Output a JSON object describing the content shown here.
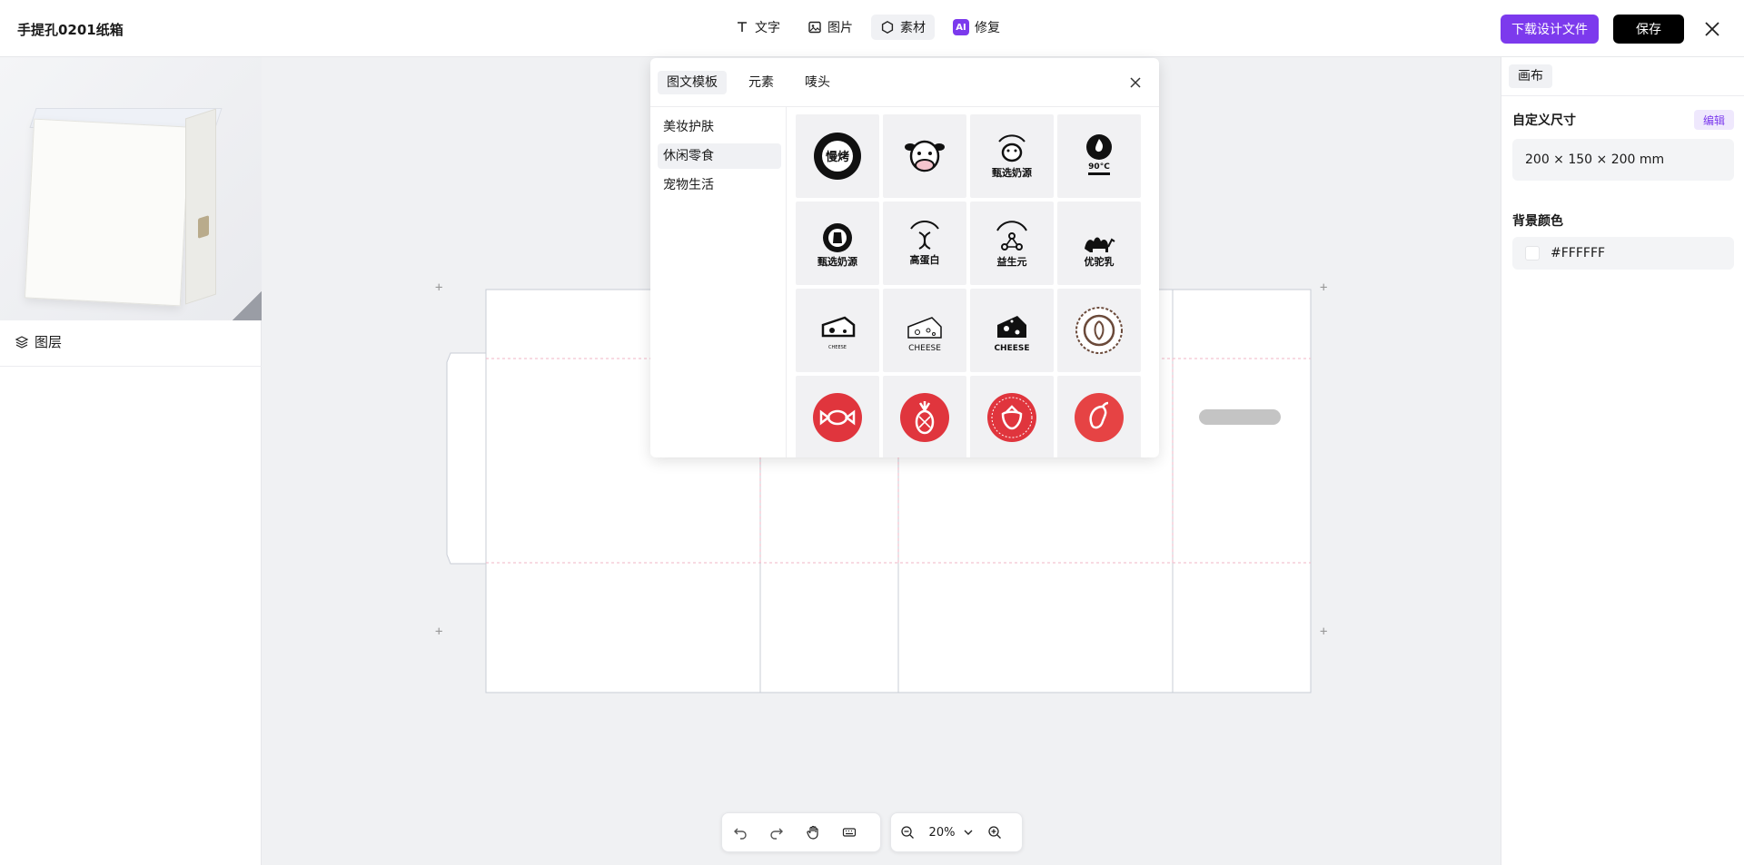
{
  "header": {
    "doc_title": "手提孔0201纸箱",
    "tools": [
      {
        "label": "文字",
        "icon": "text-icon"
      },
      {
        "label": "图片",
        "icon": "image-icon"
      },
      {
        "label": "素材",
        "icon": "hexagon-icon"
      },
      {
        "label": "修复",
        "icon": "ai-icon",
        "badge": "AI"
      }
    ],
    "download_label": "下载设计文件",
    "save_label": "保存",
    "accent_color": "#7c3aed"
  },
  "left_panel": {
    "layers_title": "图层"
  },
  "asset_panel": {
    "tabs": [
      "图文模板",
      "元素",
      "唛头"
    ],
    "categories": [
      "美妆护肤",
      "休闲零食",
      "宠物生活"
    ],
    "active_category": "休闲零食",
    "tiles": [
      {
        "icon": "slow-roast-badge-icon",
        "text": "慢烤"
      },
      {
        "icon": "cow-face-icon",
        "text": ""
      },
      {
        "icon": "milk-source-cow-icon",
        "text": "甄选奶源"
      },
      {
        "icon": "flame-90c-icon",
        "text": "90°C"
      },
      {
        "icon": "milk-jug-icon",
        "text": "甄选奶源"
      },
      {
        "icon": "dna-protein-icon",
        "text": "高蛋白"
      },
      {
        "icon": "prebiotics-icon",
        "text": "益生元"
      },
      {
        "icon": "camel-milk-icon",
        "text": "优驼乳"
      },
      {
        "icon": "cheese-small-icon",
        "text": "CHEESE"
      },
      {
        "icon": "cheese-outline-icon",
        "text": "CHEESE"
      },
      {
        "icon": "cheese-solid-icon",
        "text": "CHEESE"
      },
      {
        "icon": "coffee-seal-icon",
        "text": ""
      },
      {
        "icon": "candy-icon",
        "text": ""
      },
      {
        "icon": "pineapple-icon",
        "text": ""
      },
      {
        "icon": "strawberry-icon",
        "text": ""
      },
      {
        "icon": "mango-icon",
        "text": ""
      }
    ]
  },
  "right_panel": {
    "tab": "画布",
    "size_label": "自定义尺寸",
    "edit_label": "编辑",
    "size_value": "200 × 150 × 200 mm",
    "bg_label": "背景颜色",
    "bg_value": "#FFFFFF"
  },
  "bottom": {
    "zoom": "20%"
  }
}
